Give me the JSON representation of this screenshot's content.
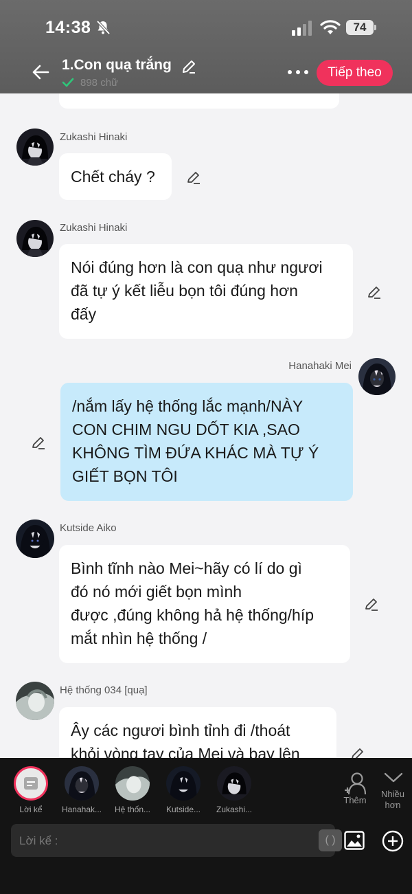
{
  "status_bar": {
    "time": "14:38",
    "battery": "74"
  },
  "header": {
    "title": "1.Con quạ trắng",
    "word_count": "898 chữ",
    "next_label": "Tiếp theo"
  },
  "messages": [
    {
      "name": "Zukashi Hinaki",
      "lines": [
        "Chết cháy ?"
      ]
    },
    {
      "name": "Zukashi Hinaki",
      "lines": [
        "Nói đúng hơn là con quạ như ngươi",
        "đã tự ý kết liễu bọn tôi đúng hơn",
        "đấy"
      ]
    },
    {
      "name": "Hanahaki Mei",
      "lines": [
        "/nắm lấy hệ thống lắc mạnh/NÀY",
        "CON CHIM NGU DỐT KIA ,SAO",
        "KHÔNG TÌM ĐỨA KHÁC MÀ TỰ Ý",
        "GIẾT BỌN TÔI"
      ]
    },
    {
      "name": "Kutside Aiko",
      "lines": [
        "Bình tĩnh nào Mei~hãy có lí do gì",
        "đó nó mới giết bọn mình",
        "được ,đúng không hả hệ thống/híp",
        "mắt nhìn hệ thống /"
      ]
    },
    {
      "name": "Hệ thống 034 [quạ]",
      "lines": [
        "Ây các ngươi bình tỉnh đi /thoát",
        "khỏi vòng tay của Mei và bay lên"
      ]
    }
  ],
  "characters": [
    {
      "label": "Lời kể"
    },
    {
      "label": "Hanahak..."
    },
    {
      "label": "Hệ thốn..."
    },
    {
      "label": "Kutside..."
    },
    {
      "label": "Zukashi..."
    }
  ],
  "actions": {
    "add_label": "Thêm",
    "more_label_1": "Nhiều",
    "more_label_2": "hơn"
  },
  "composer": {
    "placeholder": "Lời kể :",
    "paren": "( )"
  }
}
